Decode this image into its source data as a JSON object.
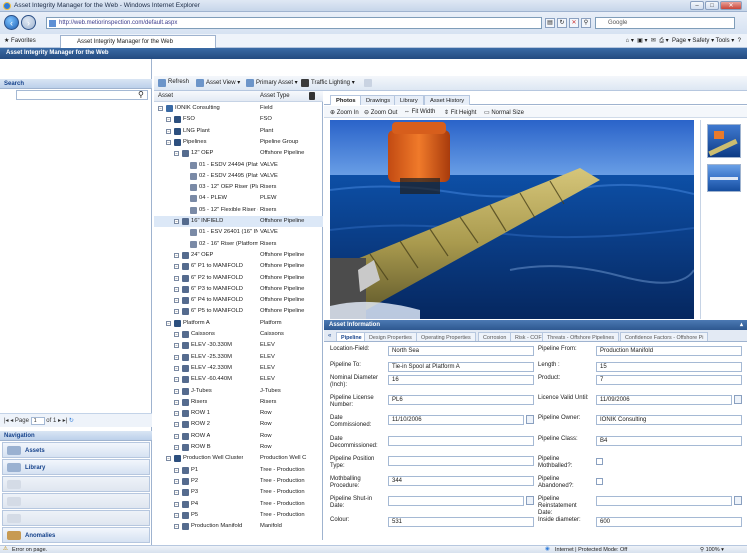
{
  "window": {
    "title": "Asset Integrity Manager for the Web - Windows Internet Explorer",
    "controls": [
      "–",
      "□",
      "✕"
    ]
  },
  "browser": {
    "url": "http://web.metiorinspection.com/default.aspx",
    "search_engine": "Google",
    "favorites_label": "Favorites",
    "tab_title": "Asset Integrity Manager for the Web",
    "tools": "Page ▾  Safety ▾  Tools ▾"
  },
  "app": {
    "header": "Asset Integrity Manager for the Web",
    "search_label": "Search",
    "pager": {
      "page_label": "Page",
      "page_value": "1",
      "of_label": "of 1"
    },
    "navigation_label": "Navigation",
    "nav_items": [
      "Assets",
      "Library",
      "",
      "",
      "",
      "Anomalies"
    ]
  },
  "toolbar": {
    "refresh": "Refresh",
    "asset_view": "Asset View ▾",
    "primary_asset": "Primary Asset ▾",
    "traffic_lighting": "Traffic Lighting ▾"
  },
  "tree": {
    "col_asset": "Asset",
    "col_type": "Asset Type",
    "rows": [
      {
        "name": "IONIK Consulting",
        "type": "Field",
        "level": 0
      },
      {
        "name": "FSO",
        "type": "FSO",
        "level": 1
      },
      {
        "name": "LNG Plant",
        "type": "Plant",
        "level": 1
      },
      {
        "name": "Pipelines",
        "type": "Pipeline Group",
        "level": 1
      },
      {
        "name": "12\" OEP",
        "type": "Offshore Pipeline",
        "level": 2
      },
      {
        "name": "01 - ESDV 24494 (Platf",
        "type": "VALVE",
        "level": 3
      },
      {
        "name": "02 - ESDV 24495 (Platf",
        "type": "VALVE",
        "level": 3
      },
      {
        "name": "03 - 12\" OEP Riser (Plat",
        "type": "Risers",
        "level": 3
      },
      {
        "name": "04 - PLEW",
        "type": "PLEW",
        "level": 3
      },
      {
        "name": "05 - 12\" Flexible Riser (",
        "type": "Risers",
        "level": 3
      },
      {
        "name": "16\" INFIELD",
        "type": "Offshore Pipeline",
        "level": 2
      },
      {
        "name": "01 - ESV 26401 (16\" IN",
        "type": "VALVE",
        "level": 3
      },
      {
        "name": "02 - 16\" Riser (Platform",
        "type": "Risers",
        "level": 3
      },
      {
        "name": "24\" OEP",
        "type": "Offshore Pipeline",
        "level": 2
      },
      {
        "name": "6\" P1 to MANIFOLD",
        "type": "Offshore Pipeline",
        "level": 2
      },
      {
        "name": "6\" P2 to MANIFOLD",
        "type": "Offshore Pipeline",
        "level": 2
      },
      {
        "name": "6\" P3 to MANIFOLD",
        "type": "Offshore Pipeline",
        "level": 2
      },
      {
        "name": "6\" P4 to MANIFOLD",
        "type": "Offshore Pipeline",
        "level": 2
      },
      {
        "name": "6\" P5 to MANIFOLD",
        "type": "Offshore Pipeline",
        "level": 2
      },
      {
        "name": "Platform A",
        "type": "Platform",
        "level": 1
      },
      {
        "name": "Caissons",
        "type": "Caissons",
        "level": 2
      },
      {
        "name": "ELEV -30.330M",
        "type": "ELEV",
        "level": 2
      },
      {
        "name": "ELEV -25.330M",
        "type": "ELEV",
        "level": 2
      },
      {
        "name": "ELEV -42.330M",
        "type": "ELEV",
        "level": 2
      },
      {
        "name": "ELEV -60.440M",
        "type": "ELEV",
        "level": 2
      },
      {
        "name": "J-Tubes",
        "type": "J-Tubes",
        "level": 2
      },
      {
        "name": "Risers",
        "type": "Risers",
        "level": 2
      },
      {
        "name": "ROW 1",
        "type": "Row",
        "level": 2
      },
      {
        "name": "ROW 2",
        "type": "Row",
        "level": 2
      },
      {
        "name": "ROW A",
        "type": "Row",
        "level": 2
      },
      {
        "name": "ROW B",
        "type": "Row",
        "level": 2
      },
      {
        "name": "Production Well Cluster",
        "type": "Production Well C",
        "level": 1
      },
      {
        "name": "P1",
        "type": "Tree - Production",
        "level": 2
      },
      {
        "name": "P2",
        "type": "Tree - Production",
        "level": 2
      },
      {
        "name": "P3",
        "type": "Tree - Production",
        "level": 2
      },
      {
        "name": "P4",
        "type": "Tree - Production",
        "level": 2
      },
      {
        "name": "P5",
        "type": "Tree - Production",
        "level": 2
      },
      {
        "name": "Production Manifold",
        "type": "Manifold",
        "level": 2
      }
    ],
    "selected_index": 10
  },
  "viewer": {
    "tabs": [
      "Photos",
      "Drawings",
      "Library",
      "Asset History"
    ],
    "tools": [
      "Zoom In",
      "Zoom Out",
      "Fit Width",
      "Fit Height",
      "Normal Size"
    ]
  },
  "asset_info": {
    "header": "Asset Information",
    "tabs": [
      "Pipeline",
      "Design Properties",
      "Operating Properties",
      "Corrosion",
      "Risk - COF",
      "Threats - Offshore Pipelines",
      "Confidence Factors - Offshore Pi"
    ],
    "left_fields": [
      {
        "label": "Location-Field:",
        "value": "North Sea"
      },
      {
        "label": "Pipeline To:",
        "value": "Tie-in Spool at Platform A"
      },
      {
        "label": "Nominal Diameter (Inch):",
        "value": "16"
      },
      {
        "label": "Pipeline License Number:",
        "value": "PL6"
      },
      {
        "label": "Date Commissioned:",
        "value": "11/10/2006"
      },
      {
        "label": "Date Decommissioned:",
        "value": ""
      },
      {
        "label": "Pipeline Position Type:",
        "value": ""
      },
      {
        "label": "Mothballing Procedure:",
        "value": "344"
      },
      {
        "label": "Pipeline Shut-in Date:",
        "value": ""
      },
      {
        "label": "Colour:",
        "value": "531"
      }
    ],
    "right_fields": [
      {
        "label": "Pipeline From:",
        "value": "Production Manifold"
      },
      {
        "label": "Length :",
        "value": "15"
      },
      {
        "label": "Product:",
        "value": "7"
      },
      {
        "label": "Licence Valid Until:",
        "value": "11/09/2006"
      },
      {
        "label": "Pipeline Owner:",
        "value": "IONIK Consulting"
      },
      {
        "label": "Pipeline Class:",
        "value": "B4"
      },
      {
        "label": "Pipeline Mothballed?:",
        "value": ""
      },
      {
        "label": "Pipeline Abandoned?:",
        "value": ""
      },
      {
        "label": "Pipeline Reinstatement Date:",
        "value": ""
      },
      {
        "label": "Inside diameter:",
        "value": "600"
      }
    ]
  },
  "status": {
    "left": "Error on page.",
    "zone": "Internet | Protected Mode: Off",
    "zoom": "100%"
  }
}
